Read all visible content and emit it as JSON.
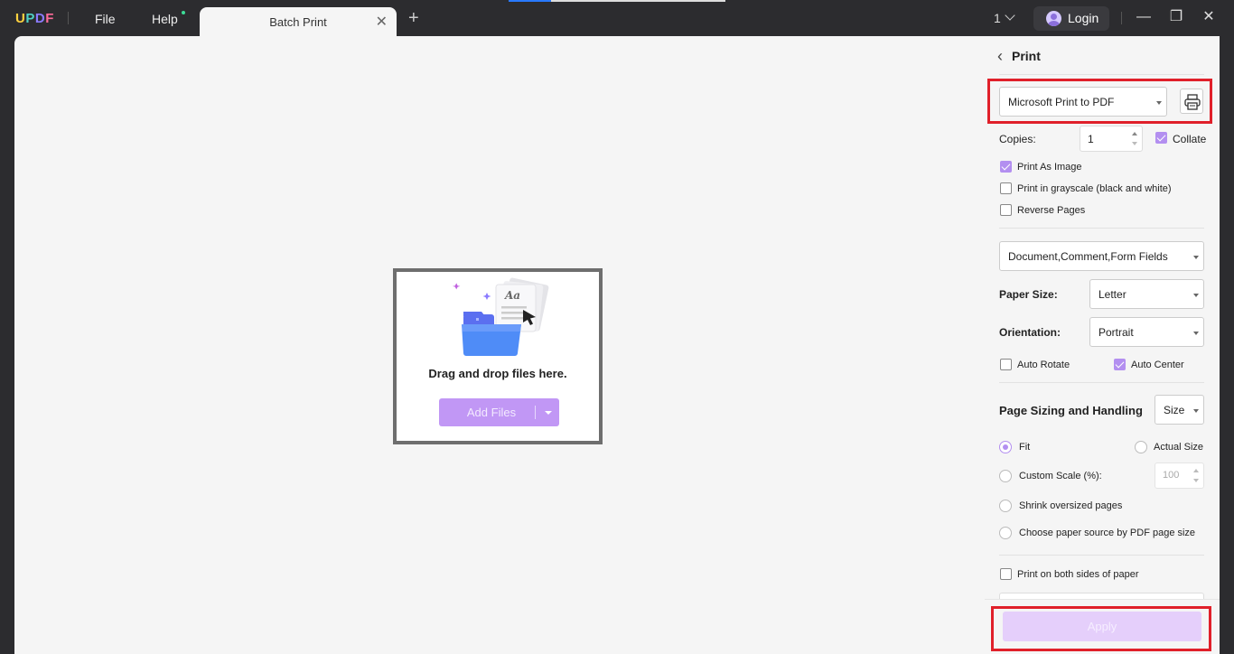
{
  "titlebar": {
    "logo": {
      "u": "U",
      "p": "P",
      "d": "D",
      "f": "F"
    },
    "menu": {
      "file": "File",
      "help": "Help"
    },
    "tab": {
      "title": "Batch Print",
      "close": "✕"
    },
    "add_tab": "+",
    "page_number": "1",
    "login": "Login",
    "window": {
      "minimize": "—",
      "restore": "❐",
      "close": "✕"
    }
  },
  "canvas": {
    "drop_text": "Drag and drop files here.",
    "add_files_label": "Add Files"
  },
  "print_panel": {
    "back": "‹",
    "title": "Print",
    "printer": "Microsoft Print to PDF",
    "copies_label": "Copies:",
    "copies_value": "1",
    "collate": {
      "label": "Collate",
      "checked": true
    },
    "print_as_image": {
      "label": "Print As Image",
      "checked": true
    },
    "grayscale": {
      "label": "Print in grayscale (black and white)",
      "checked": false
    },
    "reverse_pages": {
      "label": "Reverse Pages",
      "checked": false
    },
    "content_select": "Document,Comment,Form Fields",
    "paper_size_label": "Paper Size:",
    "paper_size": "Letter",
    "orientation_label": "Orientation:",
    "orientation": "Portrait",
    "auto_rotate": {
      "label": "Auto Rotate",
      "checked": false
    },
    "auto_center": {
      "label": "Auto Center",
      "checked": true
    },
    "page_sizing_title": "Page Sizing and Handling",
    "page_sizing_mode": "Size",
    "fit": "Fit",
    "actual_size": "Actual Size",
    "custom_scale": "Custom Scale (%):",
    "custom_scale_value": "100",
    "shrink_oversized": "Shrink oversized pages",
    "choose_paper_source": "Choose paper source by PDF page size",
    "both_sides": {
      "label": "Print on both sides of paper",
      "checked": false
    },
    "apply": "Apply",
    "selected_sizing_option": "Fit"
  },
  "colors": {
    "accent": "#b38ff0",
    "highlight": "#e0202a",
    "titlebar_bg": "#2c2c2f",
    "panel_bg": "#f5f5f5"
  }
}
